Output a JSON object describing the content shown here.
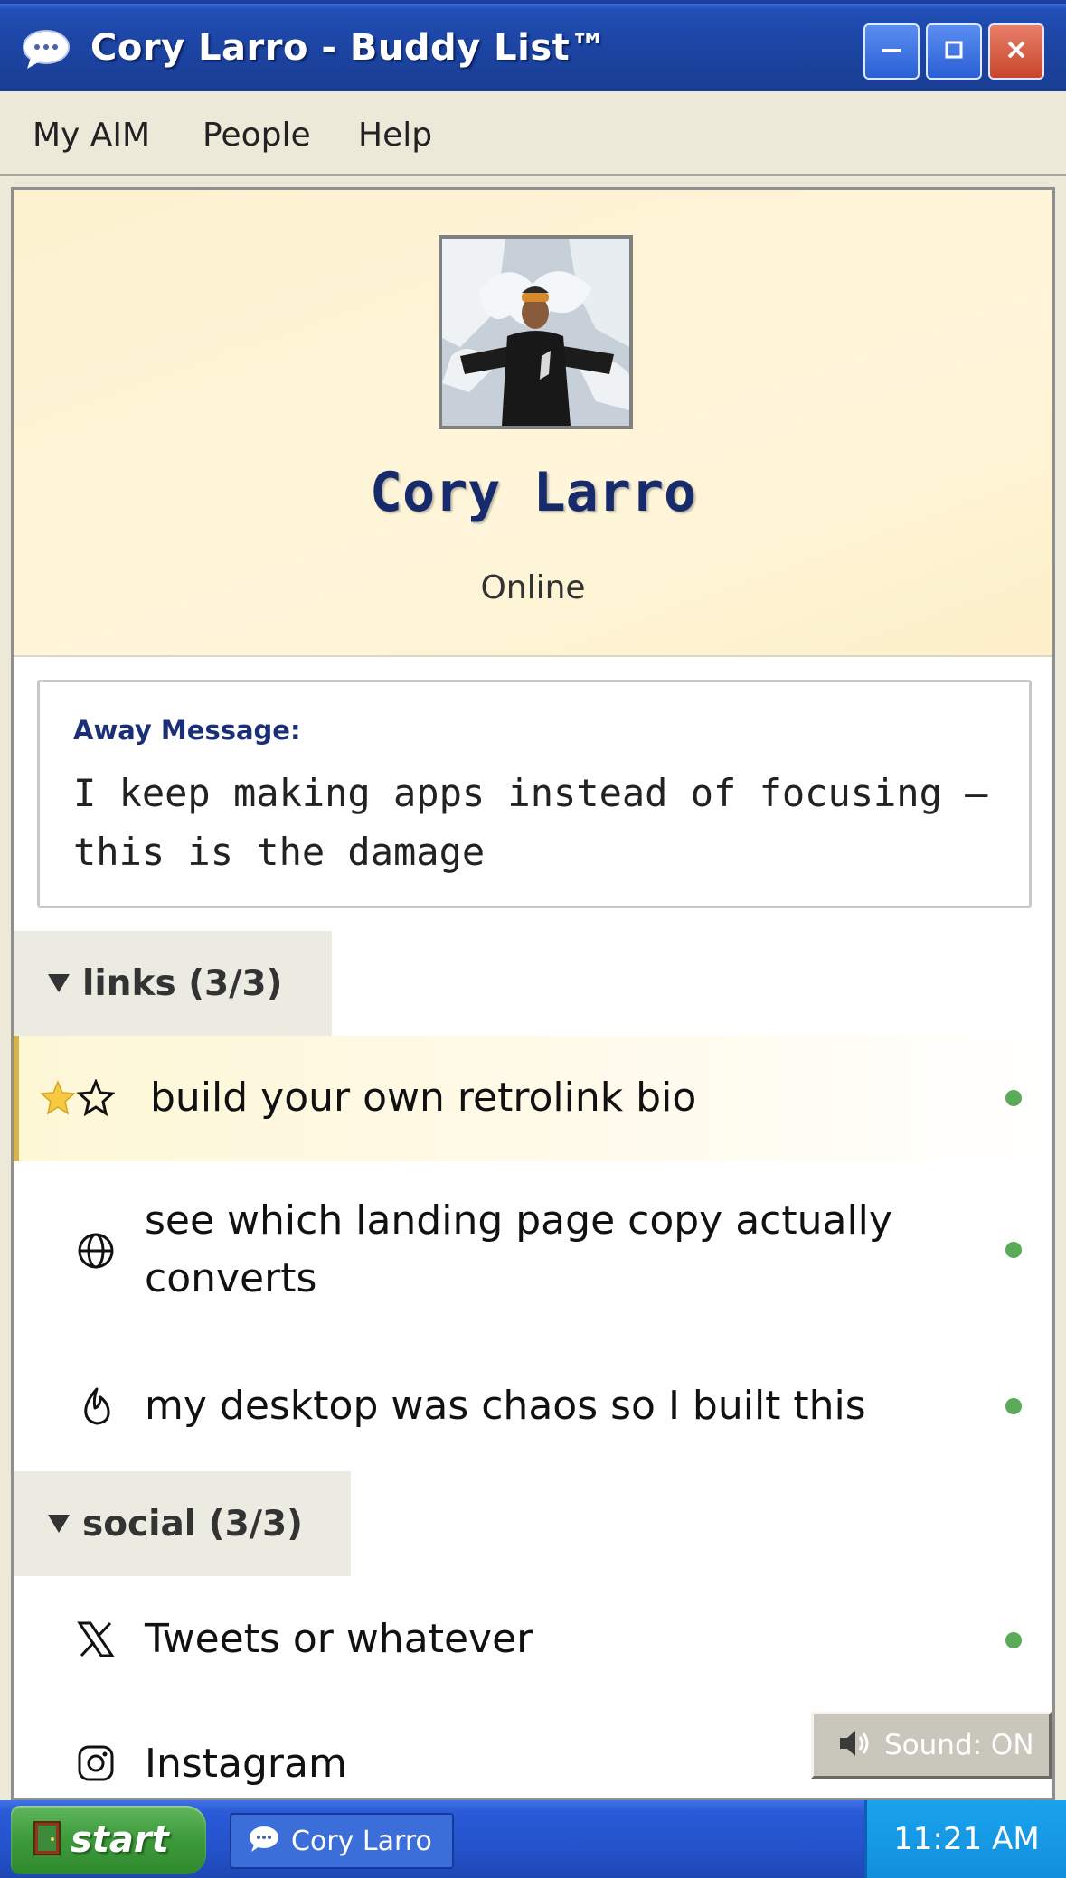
{
  "window": {
    "title": "Cory Larro - Buddy List™",
    "app_icon": "chat-bubble-icon",
    "controls": [
      "minimize-icon",
      "maximize-icon",
      "close-icon"
    ]
  },
  "menu": {
    "items": [
      "My AIM",
      "People",
      "Help"
    ]
  },
  "profile": {
    "name": "Cory Larro",
    "status": "Online"
  },
  "away": {
    "label": "Away Message:",
    "text": "I keep making apps instead of focusing — this is the damage"
  },
  "groups": [
    {
      "title": "links (3/3)",
      "items": [
        {
          "label": "build your own retrolink bio",
          "icon": "star-icon",
          "featured": true,
          "online": true
        },
        {
          "label": "see which landing page copy actually converts",
          "icon": "globe-icon",
          "online": true
        },
        {
          "label": "my desktop was chaos so I built this",
          "icon": "flame-icon",
          "online": true
        }
      ]
    },
    {
      "title": "social (3/3)",
      "items": [
        {
          "label": "Tweets or whatever",
          "icon": "x-logo-icon",
          "online": true
        },
        {
          "label": "Instagram",
          "icon": "instagram-icon",
          "online": false
        }
      ]
    }
  ],
  "sound": {
    "label": "Sound: ON",
    "icon": "speaker-icon"
  },
  "taskbar": {
    "start_label": "start",
    "task_label": "Cory Larro",
    "clock": "11:21 AM"
  },
  "colors": {
    "titlebar": "#1d46a6",
    "profile_name": "#172a6b",
    "online_dot": "#5aaa5a",
    "featured_border": "#d7b548"
  }
}
